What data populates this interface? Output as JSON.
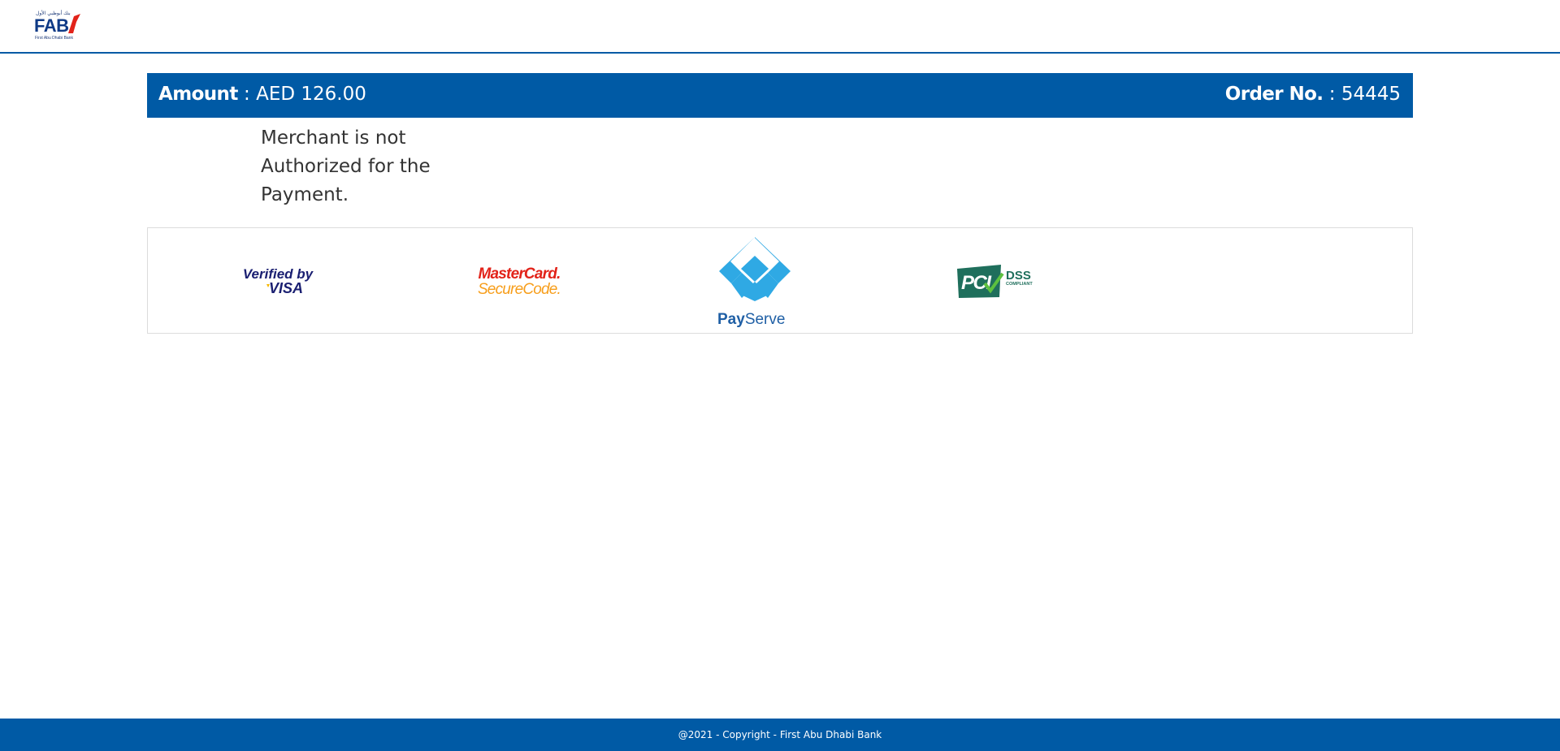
{
  "header": {
    "logo_text": "FAB",
    "logo_arabic": "بنك أبوظبي الأول",
    "logo_subtitle": "First Abu Dhabi Bank"
  },
  "payment": {
    "amount_label": "Amount",
    "amount_separator": " : ",
    "amount_value": "AED 126.00",
    "order_label": "Order No.",
    "order_separator": " : ",
    "order_value": "54445"
  },
  "message": "Merchant is not Authorized for the Payment.",
  "badges": {
    "visa_line1": "Verified by",
    "visa_line2": "VISA",
    "mc_line1": "MasterCard.",
    "mc_line2": "SecureCode.",
    "payserve_pay": "Pay",
    "payserve_serve": "Serve",
    "pci_text": "PCI",
    "pci_dss": "DSS",
    "pci_compliant": "COMPLIANT"
  },
  "footer": {
    "copyright": "@2021 - Copyright - First Abu Dhabi Bank"
  },
  "colors": {
    "brand_blue": "#005aa5",
    "payserve_blue": "#2fa9e4",
    "mastercard_red": "#e2231a",
    "mastercard_orange": "#f79e1b",
    "pci_green": "#1f6f5c"
  }
}
